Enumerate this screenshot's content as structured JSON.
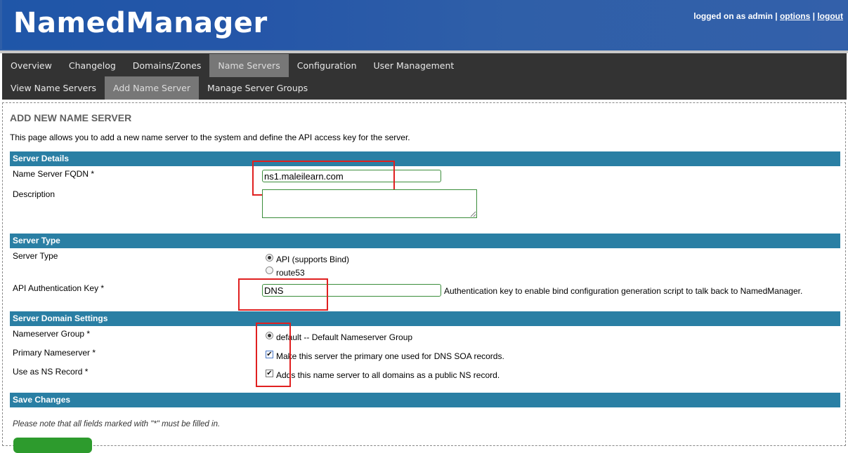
{
  "header": {
    "logo": "NamedManager",
    "logged_on": "logged on as admin",
    "sep1": "|",
    "options_label": "options",
    "sep2": "|",
    "logout_label": "logout"
  },
  "nav": {
    "primary": [
      "Overview",
      "Changelog",
      "Domains/Zones",
      "Name Servers",
      "Configuration",
      "User Management"
    ],
    "secondary": [
      "View Name Servers",
      "Add Name Server",
      "Manage Server Groups"
    ]
  },
  "page": {
    "title": "ADD NEW NAME SERVER",
    "intro": "This page allows you to add a new name server to the system and define the API access key for the server."
  },
  "sections": {
    "server_details": {
      "heading": "Server Details",
      "fqdn_label": "Name Server FQDN *",
      "fqdn_value": "ns1.maleilearn.com",
      "description_label": "Description",
      "description_value": ""
    },
    "server_type": {
      "heading": "Server Type",
      "type_label": "Server Type",
      "option_api": "API (supports Bind)",
      "option_route53": "route53",
      "selected": "API (supports Bind)",
      "api_key_label": "API Authentication Key *",
      "api_key_value": "DNS",
      "api_key_help": "Authentication key to enable bind configuration generation script to talk back to NamedManager."
    },
    "domain_settings": {
      "heading": "Server Domain Settings",
      "group_label": "Nameserver Group *",
      "group_option": "default -- Default Nameserver Group",
      "primary_label": "Primary Nameserver *",
      "primary_text": "Make this server the primary one used for DNS SOA records.",
      "primary_checked": true,
      "ns_label": "Use as NS Record *",
      "ns_text": "Adds this name server to all domains as a public NS record.",
      "ns_checked": true
    },
    "save": {
      "heading": "Save Changes",
      "note": "Please note that all fields marked with \"*\" must be filled in."
    }
  },
  "colors": {
    "header_bg": "#2f5fa8",
    "nav_bg": "#333333",
    "nav_active": "#777777",
    "section_bg": "#2a7fa4",
    "input_border": "#3a8d3a",
    "highlight": "#e02020",
    "save_button": "#2d9b2d"
  }
}
